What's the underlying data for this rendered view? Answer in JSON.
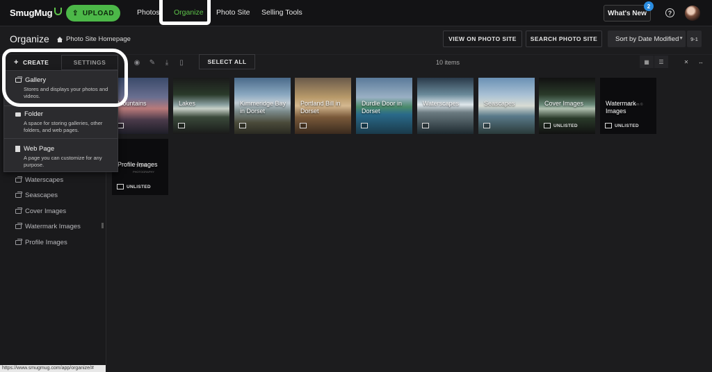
{
  "nav": {
    "logo": "SmugMug",
    "upload_label": "UPLOAD",
    "links": [
      "Photos",
      "Organize",
      "Photo Site",
      "Selling Tools"
    ],
    "active_link": "Organize",
    "whats_new_label": "What's New",
    "whats_new_badge": "2",
    "help_glyph": "?",
    "accent_color": "#5ec44a"
  },
  "header": {
    "title": "Organize",
    "breadcrumb": "Photo Site Homepage",
    "view_button": "VIEW ON PHOTO SITE",
    "search_button": "SEARCH PHOTO SITE",
    "sort_value": "Sort by Date Modified",
    "sort_dir": "9-1"
  },
  "toolbar": {
    "create_label": "CREATE",
    "settings_label": "SETTINGS",
    "select_all_label": "SELECT ALL",
    "items_count": "10 items",
    "icons": [
      "eye-icon",
      "wrench-icon",
      "download-icon",
      "trash-icon"
    ]
  },
  "create_menu": {
    "items": [
      {
        "title": "Gallery",
        "desc": "Stores and displays your photos and videos.",
        "icon": "gallery-icon"
      },
      {
        "title": "Folder",
        "desc": "A space for storing galleries, other folders, and web pages.",
        "icon": "folder-icon"
      },
      {
        "title": "Web Page",
        "desc": "A page you can customize for any purpose.",
        "icon": "page-icon"
      }
    ]
  },
  "sidebar": {
    "items": [
      "Waterscapes",
      "Seascapes",
      "Cover Images",
      "Watermark Images",
      "Profile Images"
    ]
  },
  "grid": {
    "tiles": [
      {
        "label": "Mountains",
        "unlisted": ""
      },
      {
        "label": "Lakes",
        "unlisted": ""
      },
      {
        "label": "Kimmeridge Bay in Dorset",
        "unlisted": ""
      },
      {
        "label": "Portland Bill in Dorset",
        "unlisted": ""
      },
      {
        "label": "Durdle Door in Dorset",
        "unlisted": ""
      },
      {
        "label": "Waterscapes",
        "unlisted": ""
      },
      {
        "label": "Seascapes",
        "unlisted": ""
      },
      {
        "label": "Cover Images",
        "unlisted": "UNLISTED"
      },
      {
        "label": "Watermark Images",
        "unlisted": "UNLISTED",
        "watermark_text": "phy.com ©"
      },
      {
        "label": "Profile Images",
        "unlisted": "UNLISTED",
        "brand_text": "TON",
        "brand_sub": "PHOTOGRAPHY"
      }
    ]
  },
  "status_url": "https://www.smugmug.com/app/organize/#"
}
